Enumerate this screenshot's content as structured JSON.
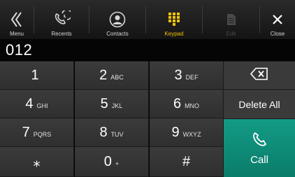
{
  "colors": {
    "accent": "#f0c400",
    "call": "#11927e",
    "key": "#353535",
    "background": "#000000"
  },
  "nav": [
    {
      "label": "Menu",
      "icon": "double-chevron-left-icon"
    },
    {
      "label": "Recents",
      "icon": "recents-phone-icon"
    },
    {
      "label": "Contacts",
      "icon": "contact-person-icon"
    },
    {
      "label": "Keypad",
      "icon": "keypad-grid-icon"
    },
    {
      "label": "Edit",
      "icon": "edit-document-icon"
    },
    {
      "label": "Close",
      "icon": "close-x-icon"
    }
  ],
  "dialer": {
    "number": "012"
  },
  "keys": [
    {
      "digit": "1",
      "letters": ""
    },
    {
      "digit": "2",
      "letters": "ABC"
    },
    {
      "digit": "3",
      "letters": "DEF"
    },
    {
      "digit": "4",
      "letters": "GHI"
    },
    {
      "digit": "5",
      "letters": "JKL"
    },
    {
      "digit": "6",
      "letters": "MNO"
    },
    {
      "digit": "7",
      "letters": "PQRS"
    },
    {
      "digit": "8",
      "letters": "TUV"
    },
    {
      "digit": "9",
      "letters": "WXYZ"
    },
    {
      "digit": "⁎",
      "letters": ""
    },
    {
      "digit": "0",
      "letters": "+"
    },
    {
      "digit": "#",
      "letters": ""
    }
  ],
  "actions": {
    "backspace_icon": "backspace-icon",
    "delete_all_label": "Delete All",
    "call_label": "Call",
    "call_icon": "phone-handset-icon"
  }
}
